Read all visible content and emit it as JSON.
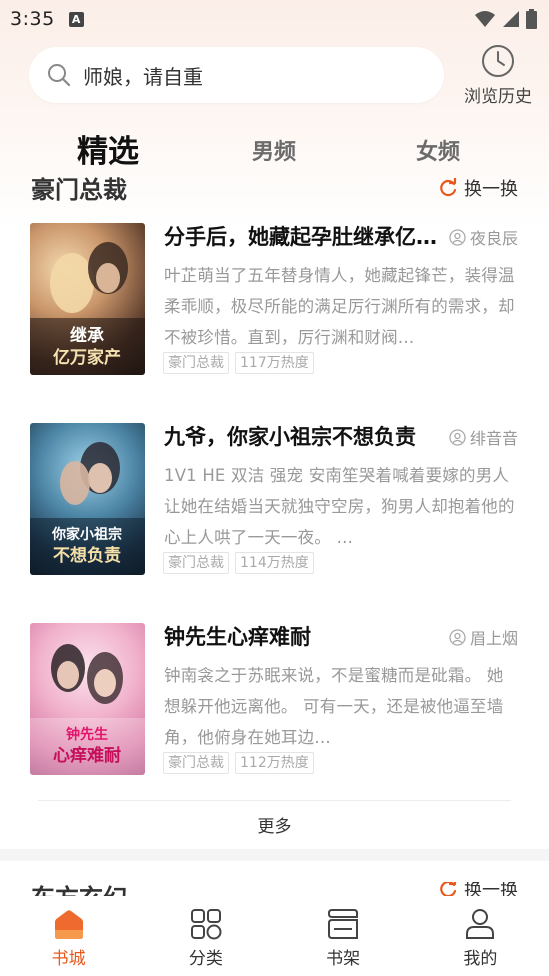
{
  "status_bar": {
    "time": "3:35",
    "notif_letter": "A"
  },
  "search": {
    "placeholder": "师娘，请自重"
  },
  "history": {
    "label": "浏览历史"
  },
  "tabs": [
    {
      "label": "精选",
      "active": true
    },
    {
      "label": "男频",
      "active": false
    },
    {
      "label": "女频",
      "active": false
    }
  ],
  "section": {
    "title": "豪门总裁",
    "refresh_label": "换一换"
  },
  "books": [
    {
      "title": "分手后，她藏起孕肚继承亿万家产",
      "author": "夜良辰",
      "desc": "叶芷萌当了五年替身情人，她藏起锋芒，装得温柔乖顺，极尽所能的满足厉行渊所有的需求，却不被珍惜。直到，厉行渊和财阀…",
      "tags": [
        "豪门总裁",
        "117万热度"
      ],
      "cover_text": "继承亿万家产"
    },
    {
      "title": "九爷，你家小祖宗不想负责",
      "author": "绯音音",
      "desc": "1V1  HE 双洁  强宠      安南笙哭着喊着要嫁的男人让她在结婚当天就独守空房，狗男人却抱着他的心上人哄了一天一夜。      …",
      "tags": [
        "豪门总裁",
        "114万热度"
      ],
      "cover_text": "你家小祖宗不想负责"
    },
    {
      "title": "钟先生心痒难耐",
      "author": "眉上烟",
      "desc": "钟南衾之于苏眠来说，不是蜜糖而是砒霜。      她想躲开他远离他。        可有一天，还是被他逼至墙角，他俯身在她耳边…",
      "tags": [
        "豪门总裁",
        "112万热度"
      ],
      "cover_text": "钟先生心痒难耐"
    }
  ],
  "more_label": "更多",
  "next_section": {
    "title": "东方玄幻",
    "refresh_label": "换一换"
  },
  "bottom_nav": [
    {
      "label": "书城",
      "icon": "home-icon",
      "active": true
    },
    {
      "label": "分类",
      "icon": "category-grid-icon",
      "active": false
    },
    {
      "label": "书架",
      "icon": "bookshelf-icon",
      "active": false
    },
    {
      "label": "我的",
      "icon": "profile-icon",
      "active": false
    }
  ],
  "colors": {
    "accent": "#e8581c",
    "muted_text": "#999999"
  }
}
